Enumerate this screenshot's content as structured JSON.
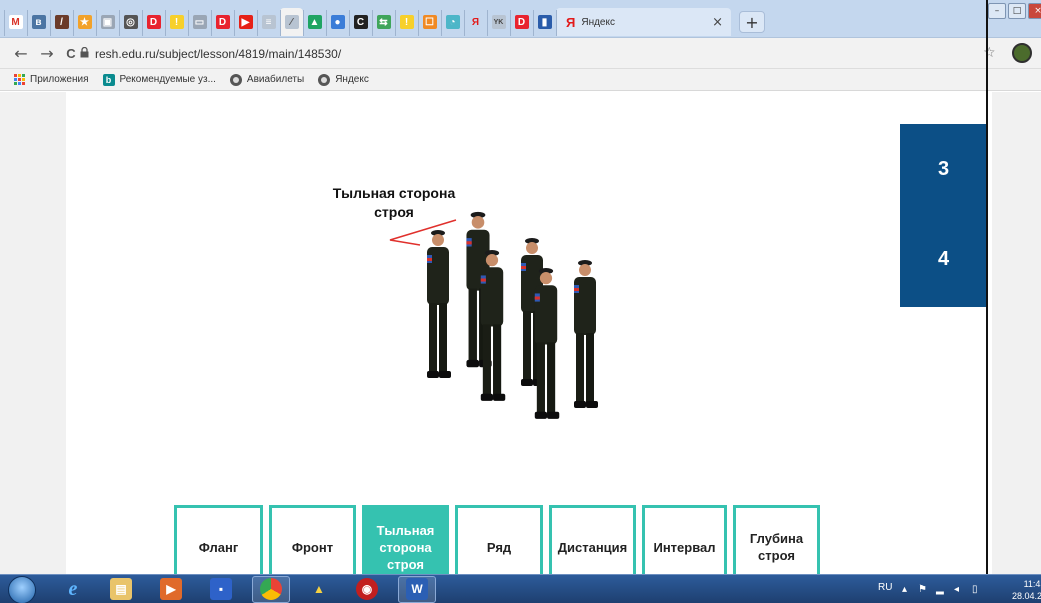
{
  "browser": {
    "active_tab_icon": "resh-icon",
    "yandex_tab": {
      "letter": "Я",
      "title": "Яндекс",
      "close": "×"
    },
    "new_tab": "+",
    "window_controls": {
      "minimize": "–",
      "maximize": "□",
      "close": "×"
    }
  },
  "toolbar": {
    "back": "←",
    "forward": "→",
    "reload": "C",
    "url": "resh.edu.ru/subject/lesson/4819/main/148530/",
    "star": "☆"
  },
  "bookmarks": [
    {
      "label": "Приложения",
      "icon": "apps-icon"
    },
    {
      "label": "Рекомендуемые уз...",
      "icon": "bing-icon"
    },
    {
      "label": "Авиабилеты",
      "icon": "globe-icon"
    },
    {
      "label": "Яндекс",
      "icon": "globe-icon"
    }
  ],
  "side_nav": {
    "items": [
      "3",
      "4"
    ],
    "color": "#0c4f86"
  },
  "scene": {
    "title_line1": "Тыльная сторона",
    "title_line2": "строя"
  },
  "terms": [
    {
      "label": "Фланг",
      "selected": false
    },
    {
      "label": "Фронт",
      "selected": false
    },
    {
      "label": "Тыльная сторона строя",
      "selected": true
    },
    {
      "label": "Ряд",
      "selected": false
    },
    {
      "label": "Дистанция",
      "selected": false
    },
    {
      "label": "Интервал",
      "selected": false
    },
    {
      "label": "Глубина строя",
      "selected": false
    }
  ],
  "taskbar": {
    "lang": "RU",
    "time": "11:43",
    "date": "28.04.2020"
  },
  "colors": {
    "accent": "#35c2b0",
    "nav": "#0c4f86"
  }
}
